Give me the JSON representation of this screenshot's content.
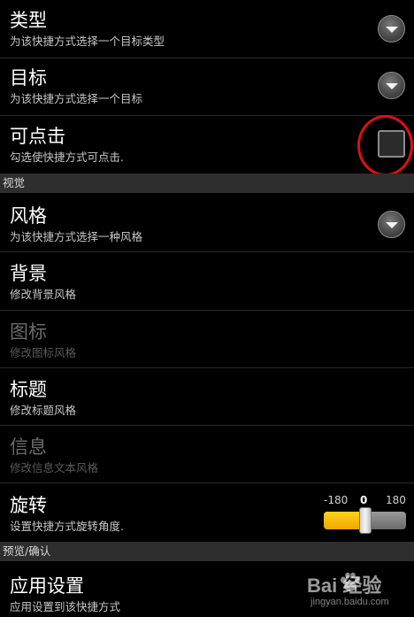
{
  "items": [
    {
      "title": "类型",
      "summary": "为该快捷方式选择一个目标类型"
    },
    {
      "title": "目标",
      "summary": "为该快捷方式选择一个目标"
    },
    {
      "title": "可点击",
      "summary": "勾选使快捷方式可点击."
    },
    {
      "title": "风格",
      "summary": "为该快捷方式选择一种风格"
    },
    {
      "title": "背景",
      "summary": "修改背景风格"
    },
    {
      "title": "图标",
      "summary": "修改图标风格"
    },
    {
      "title": "标题",
      "summary": "修改标题风格"
    },
    {
      "title": "信息",
      "summary": "修改信息文本风格"
    },
    {
      "title": "旋转",
      "summary": "设置快捷方式旋转角度."
    },
    {
      "title": "应用设置",
      "summary": "应用设置到该快捷方式"
    }
  ],
  "sections": {
    "visual": "视觉",
    "preview": "预览/确认"
  },
  "rotation_slider": {
    "min_label": "-180",
    "value_label": "0",
    "max_label": "180",
    "min": -180,
    "max": 180,
    "value": 0
  },
  "clickable_checked": false,
  "watermark": {
    "logo_text": "Bai  经验",
    "url": "jingyan.baidu.com"
  },
  "colors": {
    "background": "#000000",
    "section_header": "#2e2e2e",
    "slider_fill": "#ffc20e",
    "highlight_ring": "#e01010"
  }
}
